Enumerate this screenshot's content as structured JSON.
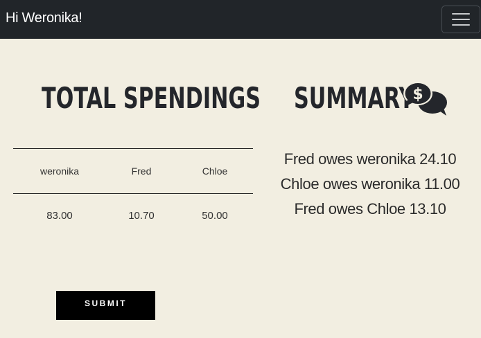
{
  "navbar": {
    "greeting": "Hi Weronika!",
    "menu_icon": "hamburger-menu-icon"
  },
  "spendings": {
    "title": "TOTAL SPENDINGS",
    "columns": [
      "weronika",
      "Fred",
      "Chloe"
    ],
    "values": [
      "83.00",
      "10.70",
      "50.00"
    ]
  },
  "summary": {
    "title": "SUMMARY",
    "icon": "money-chat-bubbles-icon",
    "lines": [
      "Fred owes weronika 24.10",
      "Chloe owes weronika 11.00",
      "Fred owes Chloe 13.10"
    ]
  },
  "form": {
    "submit_label": "SUBMIT"
  },
  "colors": {
    "navbar_bg": "#212529",
    "page_bg": "#f2eee1",
    "button_bg": "#000000"
  }
}
